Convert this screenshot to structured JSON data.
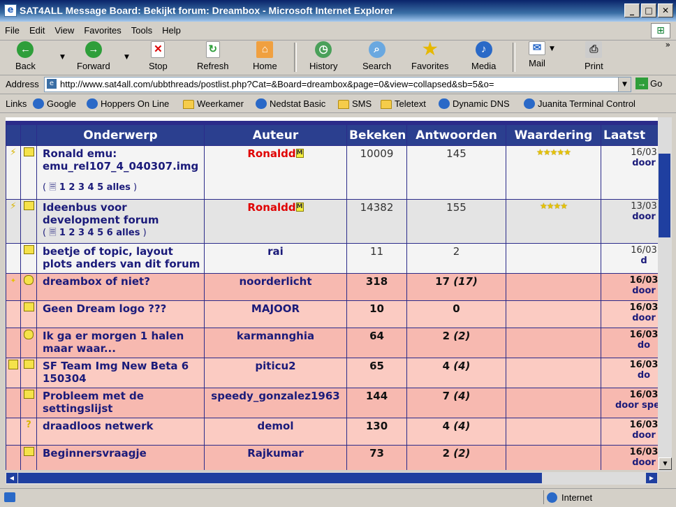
{
  "window": {
    "title": "SAT4ALL Message Board: Bekijkt forum: Dreambox - Microsoft Internet Explorer"
  },
  "menu": [
    "File",
    "Edit",
    "View",
    "Favorites",
    "Tools",
    "Help"
  ],
  "toolbar": {
    "back": "Back",
    "forward": "Forward",
    "stop": "Stop",
    "refresh": "Refresh",
    "home": "Home",
    "history": "History",
    "search": "Search",
    "favorites": "Favorites",
    "media": "Media",
    "mail": "Mail",
    "print": "Print"
  },
  "address": {
    "label": "Address",
    "url": "http://www.sat4all.com/ubbthreads/postlist.php?Cat=&Board=dreambox&page=0&view=collapsed&sb=5&o=",
    "go": "Go"
  },
  "links": {
    "label": "Links",
    "items": [
      "Google",
      "Hoppers On Line",
      "Weerkamer",
      "Nedstat Basic",
      "SMS",
      "Teletext",
      "Dynamic DNS",
      "Juanita Terminal Control"
    ]
  },
  "table": {
    "headers": {
      "subject": "Onderwerp",
      "author": "Auteur",
      "views": "Bekeken",
      "replies": "Antwoorden",
      "rating": "Waardering",
      "last": "Laatst"
    },
    "rows": [
      {
        "subject": "Ronald emu: emu_rel107_4_040307.img",
        "pages": "1 2 3 4 5 alles",
        "author": "Ronaldd",
        "views": "10009",
        "replies": "145",
        "rating": "★★★★★",
        "last_date": "16/03",
        "last_by": "door"
      },
      {
        "subject": "Ideenbus voor development forum",
        "pages": "1 2 3 4 5 6 alles",
        "author": "Ronaldd",
        "views": "14382",
        "replies": "155",
        "rating": "★★★★",
        "last_date": "13/03",
        "last_by": "door"
      },
      {
        "subject": "beetje of topic, layout plots anders van dit forum",
        "author": "rai",
        "views": "11",
        "replies": "2",
        "last_date": "16/03",
        "last_by": "d"
      },
      {
        "subject": "dreambox of niet?",
        "author": "noorderlicht",
        "views": "318",
        "replies": "17",
        "replies_new": "(17)",
        "last_date": "16/03",
        "last_by": "door"
      },
      {
        "subject": "Geen Dream logo ???",
        "author": "MAJOOR",
        "views": "10",
        "replies": "0",
        "last_date": "16/03",
        "last_by": "door"
      },
      {
        "subject": "Ik ga er morgen 1 halen maar waar...",
        "author": "karmannghia",
        "views": "64",
        "replies": "2",
        "replies_new": "(2)",
        "last_date": "16/03",
        "last_by": "do"
      },
      {
        "subject": "SF Team Img New Beta 6 150304",
        "author": "piticu2",
        "views": "65",
        "replies": "4",
        "replies_new": "(4)",
        "last_date": "16/03",
        "last_by": "do"
      },
      {
        "subject": "Probleem met de settingslijst",
        "author": "speedy_gonzalez1963",
        "views": "144",
        "replies": "7",
        "replies_new": "(4)",
        "last_date": "16/03",
        "last_by": "door speed"
      },
      {
        "subject": "draadloos netwerk",
        "author": "demol",
        "views": "130",
        "replies": "4",
        "replies_new": "(4)",
        "last_date": "16/03",
        "last_by": "door"
      },
      {
        "subject": "Beginnersvraagje",
        "author": "Rajkumar",
        "views": "73",
        "replies": "2",
        "replies_new": "(2)",
        "last_date": "16/03",
        "last_by": "door"
      }
    ]
  },
  "status": {
    "zone": "Internet"
  }
}
